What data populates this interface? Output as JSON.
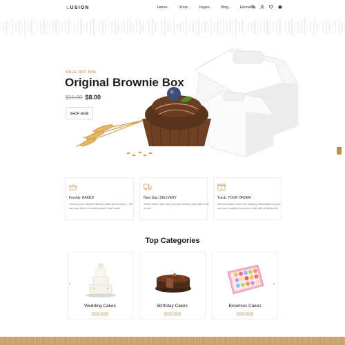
{
  "header": {
    "logo": "LUSION",
    "nav": [
      "Home",
      "Shop",
      "Pages",
      "Blog",
      "Elements"
    ],
    "icons": [
      "search-icon",
      "user-icon",
      "heart-icon",
      "cart-icon"
    ]
  },
  "hero": {
    "sale": "SALE OFF 50%",
    "title": "Original Brownie Box",
    "old_price": "$16.00",
    "new_price": "$8.00",
    "button": "SHOP NOW"
  },
  "features": [
    {
      "title": "Freshly: BAKED",
      "desc": "Choose your desired delivery date at checkout – We can also leave in a safe place if not home!",
      "icon": "cake-icon"
    },
    {
      "title": "Next Day: DELIVERY",
      "desc": "Order before 2pm and you can receive your within 24 hours!",
      "icon": "delivery-truck-icon"
    },
    {
      "title": "Track: YOUR ORDER",
      "desc": "We will email or text live tracking information so you can see exactly when your order will be delivered!",
      "icon": "gift-box-icon"
    }
  ],
  "categories": {
    "heading": "Top Categories",
    "items": [
      {
        "name": "Wedding Cakes",
        "link": "SHOP NOW"
      },
      {
        "name": "Birthday Cakes",
        "link": "SHOP NOW"
      },
      {
        "name": "Brownies Cakes",
        "link": "SHOP NOW"
      }
    ],
    "prev": "‹",
    "next": "›"
  },
  "colors": {
    "accent": "#c9a25f",
    "footer_band": "#cda874",
    "side_tab": "#b98d4e"
  }
}
